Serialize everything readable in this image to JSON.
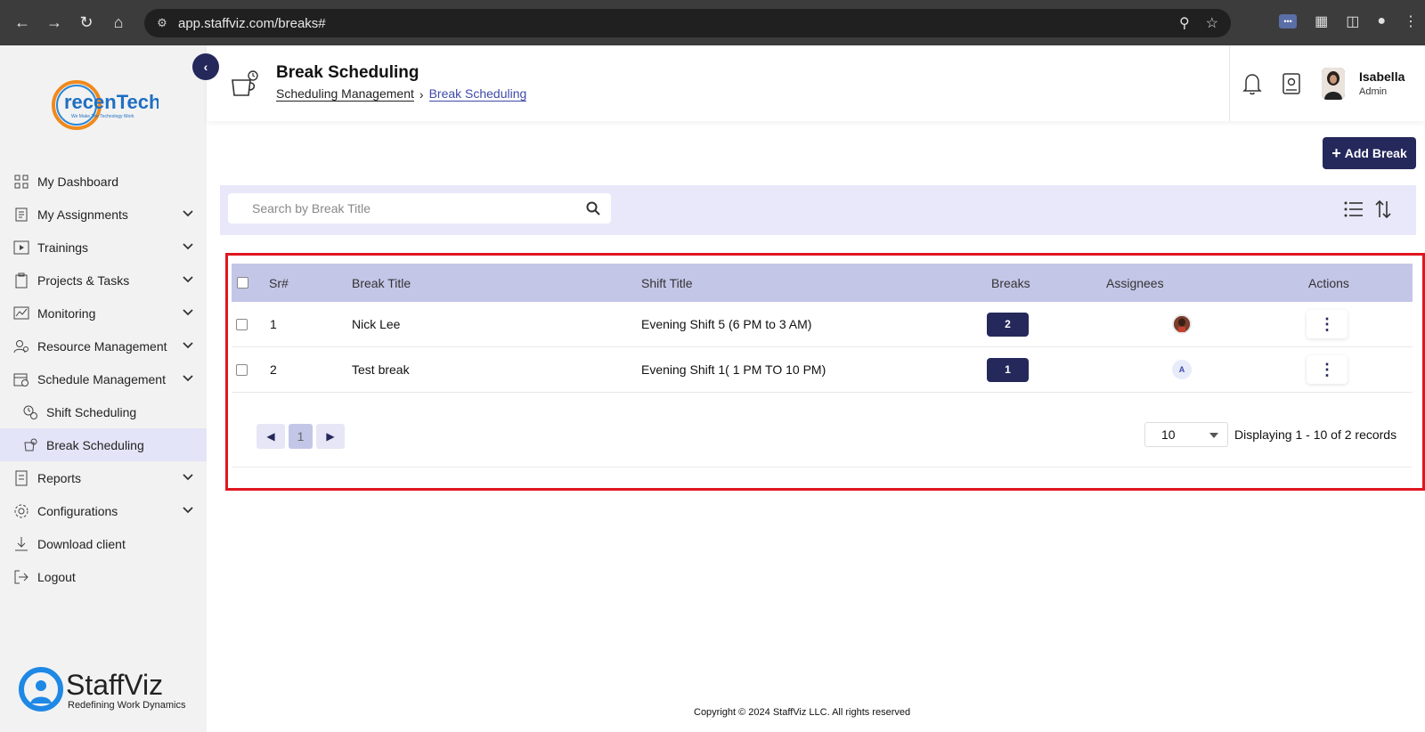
{
  "browser": {
    "url": "app.staffviz.com/breaks#"
  },
  "sidebar": {
    "items": [
      {
        "label": "My Dashboard"
      },
      {
        "label": "My Assignments"
      },
      {
        "label": "Trainings"
      },
      {
        "label": "Projects & Tasks"
      },
      {
        "label": "Monitoring"
      },
      {
        "label": "Resource Management"
      },
      {
        "label": "Schedule Management"
      },
      {
        "label": "Shift Scheduling"
      },
      {
        "label": "Break Scheduling"
      },
      {
        "label": "Reports"
      },
      {
        "label": "Configurations"
      },
      {
        "label": "Download client"
      },
      {
        "label": "Logout"
      }
    ],
    "logo_main": "recenTech",
    "logo_tag": "We Make The Technology Work",
    "brand_name": "StaffViz",
    "brand_tagline": "Redefining Work Dynamics"
  },
  "header": {
    "title": "Break Scheduling",
    "breadcrumb": [
      "Scheduling Management",
      "Break Scheduling"
    ],
    "user_name": "Isabella",
    "user_role": "Admin"
  },
  "toolbar": {
    "add_label": "Add Break",
    "search_placeholder": "Search by Break Title"
  },
  "table": {
    "columns": [
      "Sr#",
      "Break Title",
      "Shift Title",
      "Breaks",
      "Assignees",
      "Actions"
    ],
    "rows": [
      {
        "sr": "1",
        "title": "Nick Lee",
        "shift": "Evening Shift 5 (6 PM to 3 AM)",
        "breaks": "2",
        "assignee": ""
      },
      {
        "sr": "2",
        "title": "Test break",
        "shift": "Evening Shift 1( 1 PM TO 10 PM)",
        "breaks": "1",
        "assignee": "A"
      }
    ]
  },
  "pagination": {
    "current_page": "1",
    "page_size": "10",
    "records_text": "Displaying 1 - 10 of 2 records"
  },
  "footer": {
    "copyright": "Copyright © 2024 StaffViz LLC. All rights reserved"
  },
  "colors": {
    "primary": "#24285b",
    "highlight_border": "#e0161f",
    "table_header": "#c4c6e8",
    "filter_bar": "#e8e8fa"
  }
}
